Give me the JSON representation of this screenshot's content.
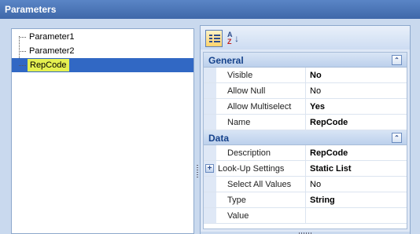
{
  "window": {
    "title": "Parameters"
  },
  "tree": {
    "items": [
      {
        "label": "Parameter1"
      },
      {
        "label": "Parameter2"
      },
      {
        "label": "RepCode"
      }
    ]
  },
  "toolbar": {
    "categorized_icon": "categorized-view-icon",
    "alphabetical_icon": "sort-az-icon",
    "alphabetical_label": "AZ"
  },
  "grid": {
    "categories": [
      {
        "name": "General"
      },
      {
        "name": "Data"
      }
    ],
    "general": [
      {
        "name": "Visible",
        "value": "No"
      },
      {
        "name": "Allow Null",
        "value": "No"
      },
      {
        "name": "Allow Multiselect",
        "value": "Yes"
      },
      {
        "name": "Name",
        "value": "RepCode"
      }
    ],
    "data": [
      {
        "name": "Description",
        "value": "RepCode"
      },
      {
        "name": "Look-Up Settings",
        "value": "Static List"
      },
      {
        "name": "Select All Values",
        "value": "No"
      },
      {
        "name": "Type",
        "value": "String"
      },
      {
        "name": "Value",
        "value": ""
      }
    ]
  },
  "colors": {
    "titlebar": "#4a76b8",
    "selection": "#3168c4",
    "highlight": "#e5f050",
    "category_text": "#15428b"
  }
}
